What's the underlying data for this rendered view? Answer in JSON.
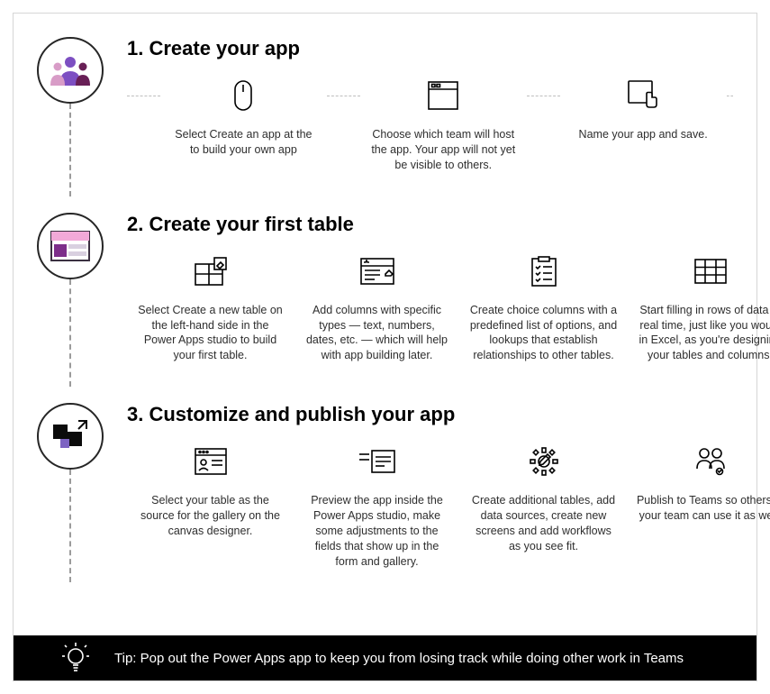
{
  "steps": [
    {
      "title": "1. Create your app",
      "subs": [
        {
          "text": "Select Create an app at the to build your own app"
        },
        {
          "text": "Choose which team will host the app. Your app will not yet be visible to others."
        },
        {
          "text": "Name your app and save."
        }
      ]
    },
    {
      "title": "2. Create your first table",
      "subs": [
        {
          "text": "Select Create a new table on the left-hand side in the Power Apps studio to build your first table."
        },
        {
          "text": "Add columns with specific types — text, numbers, dates, etc. — which will help with app building later."
        },
        {
          "text": "Create choice columns with a predefined list of options, and lookups that establish relationships to other tables."
        },
        {
          "text": "Start filling in rows of data in real time, just like you would in Excel, as you're designing your tables and columns."
        }
      ]
    },
    {
      "title": "3. Customize and publish your app",
      "subs": [
        {
          "text": "Select your table as the source for the gallery on the canvas designer."
        },
        {
          "text": "Preview the app inside the Power Apps studio, make some adjustments to the fields that show up in the form and gallery."
        },
        {
          "text": "Create additional tables, add data sources, create new screens and add workflows as you see fit."
        },
        {
          "text": "Publish to Teams so others in your team can use it as well."
        }
      ]
    }
  ],
  "tip": "Tip: Pop out the Power Apps app to keep you from losing track while doing other work in Teams"
}
